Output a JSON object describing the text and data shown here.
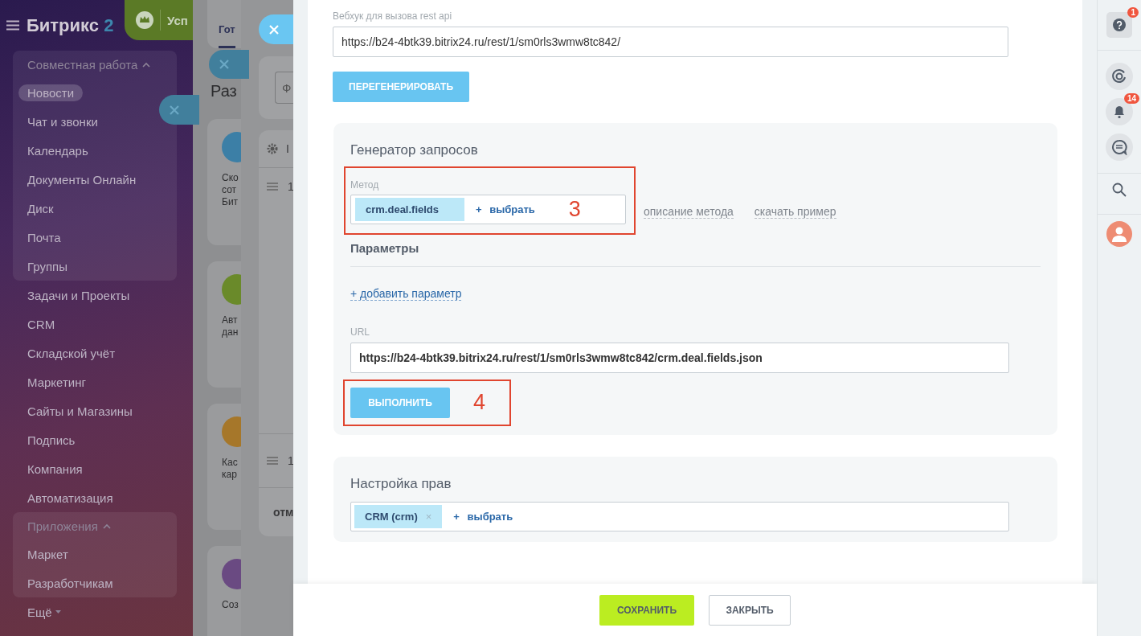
{
  "sidebar": {
    "logo": "Битрикс",
    "logo_number": "2",
    "sections": [
      {
        "kind": "group",
        "title": "Совместная работа",
        "expanded": true,
        "items": [
          {
            "label": "Новости",
            "selected": true
          },
          {
            "label": "Чат и звонки",
            "selected": false
          },
          {
            "label": "Календарь",
            "selected": false
          },
          {
            "label": "Документы Онлайн",
            "selected": false
          },
          {
            "label": "Диск",
            "selected": false
          },
          {
            "label": "Почта",
            "selected": false
          },
          {
            "label": "Группы",
            "selected": false
          }
        ]
      },
      {
        "kind": "plain",
        "items": [
          {
            "label": "Задачи и Проекты",
            "selected": false
          },
          {
            "label": "CRM",
            "selected": false
          },
          {
            "label": "Складской учёт",
            "selected": false
          },
          {
            "label": "Маркетинг",
            "selected": false
          },
          {
            "label": "Сайты и Магазины",
            "selected": false
          },
          {
            "label": "Подпись",
            "selected": false
          },
          {
            "label": "Компания",
            "selected": false
          },
          {
            "label": "Автоматизация",
            "selected": false
          }
        ]
      },
      {
        "kind": "group",
        "title": "Приложения",
        "expanded": true,
        "items": [
          {
            "label": "Маркет",
            "selected": false
          },
          {
            "label": "Разработчикам",
            "selected": false
          }
        ]
      }
    ],
    "more": "Ещё"
  },
  "promo_badge": {
    "text": "Усп"
  },
  "back_panel_1": {
    "tab": "Гот",
    "heading": "Раз",
    "cards": [
      {
        "lines": [
          "Ско",
          "сот",
          "Бит"
        ],
        "color": "#3c7fa6"
      },
      {
        "lines": [
          "Авт",
          "дан"
        ],
        "color": "#6a8a2a"
      },
      {
        "lines": [
          "Кас",
          "кар"
        ],
        "color": "#a6772a"
      },
      {
        "lines": [
          "Соз"
        ],
        "color": "#6a4a82"
      }
    ]
  },
  "back_panel_2": {
    "filter_text": "Ф",
    "header_text": "I",
    "rows": [
      "1",
      "1"
    ],
    "footer_text": "отм"
  },
  "webhook": {
    "label": "Вебхук для вызова rest api",
    "value": "https://b24-4btk39.bitrix24.ru/rest/1/sm0rls3wmw8tc842/",
    "regenerate_button": "ПЕРЕГЕНЕРИРОВАТЬ"
  },
  "request_generator": {
    "title": "Генератор запросов",
    "method_label": "Метод",
    "method_tag": "crm.deal.fields",
    "select_link": "+ выбрать",
    "annotation": "3",
    "links": [
      "описание метода",
      "скачать пример"
    ],
    "params_title": "Параметры",
    "add_param": "+ добавить параметр",
    "url_label": "URL",
    "url_value": "https://b24-4btk39.bitrix24.ru/rest/1/sm0rls3wmw8tc842/crm.deal.fields.json",
    "run_button": "ВЫПОЛНИТЬ",
    "run_annotation": "4"
  },
  "permissions": {
    "title": "Настройка прав",
    "tags": [
      {
        "label": "CRM (crm)",
        "remove": "×"
      }
    ],
    "select_link": "+ выбрать"
  },
  "footer_buttons": [
    {
      "label": "СОХРАНИТЬ",
      "kind": "primary"
    },
    {
      "label": "ЗАКРЫТЬ",
      "kind": "secondary"
    }
  ],
  "right_bar": {
    "help_badge": "1",
    "notifications_badge": "14"
  }
}
